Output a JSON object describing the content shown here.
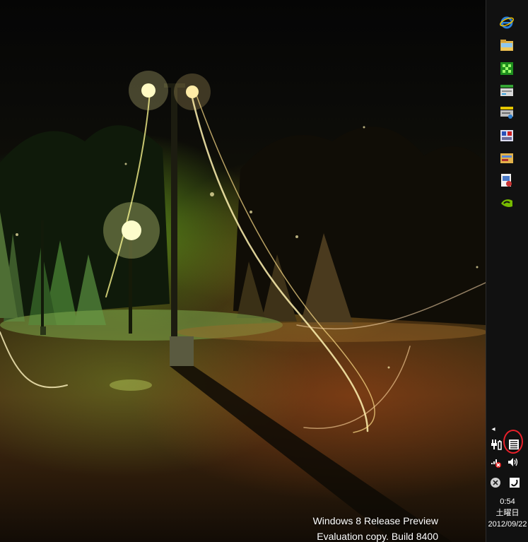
{
  "taskbar": {
    "pinned_apps": [
      {
        "name": "internet-explorer-icon"
      },
      {
        "name": "file-explorer-icon"
      },
      {
        "name": "green-app-icon"
      },
      {
        "name": "drive-app-icon"
      },
      {
        "name": "network-drive-icon"
      },
      {
        "name": "utility-app-icon"
      },
      {
        "name": "tools-app-icon"
      },
      {
        "name": "media-app-icon"
      },
      {
        "name": "nvidia-icon"
      }
    ]
  },
  "tray": {
    "overflow_arrow": "◂",
    "icons": [
      "power-plug-icon",
      "action-center-icon",
      "network-icon",
      "volume-icon",
      "close-circle-icon",
      "app-tray-icon"
    ],
    "highlight_color": "#e8202a"
  },
  "clock": {
    "time": "0:54",
    "weekday": "土曜日",
    "date": "2012/09/22"
  },
  "watermark": {
    "line1": "Windows 8 Release Preview",
    "line2": "Evaluation copy. Build 8400"
  },
  "colors": {
    "taskbar_bg": "#111111",
    "ie_blue": "#2b7fd8",
    "nvidia_green": "#76b900"
  }
}
